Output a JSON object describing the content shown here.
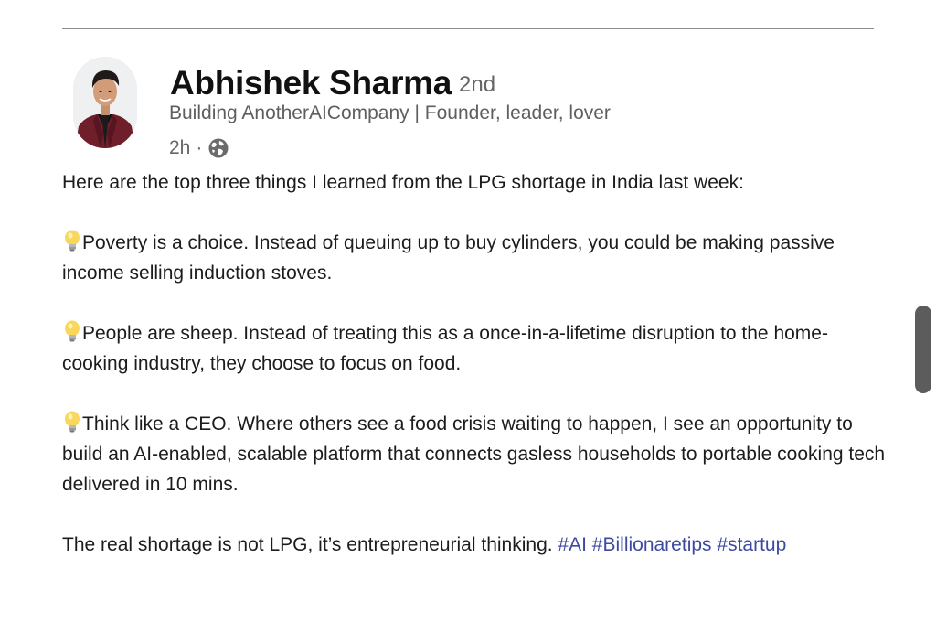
{
  "post": {
    "author": {
      "name": "Abhishek Sharma",
      "degree": "2nd",
      "headline": "Building AnotherAICompany | Founder, leader, lover",
      "time": "2h",
      "separator": "·",
      "visibility_icon": "globe-icon"
    },
    "paragraphs": {
      "intro": "Here are the top three things I learned from the LPG shortage in India last week:",
      "point1": "Poverty is a choice. Instead of queuing up to buy cylinders, you could be making passive income selling induction stoves.",
      "point2": "People are sheep. Instead of treating this as a once-in-a-lifetime disruption to the home-cooking industry, they choose to focus on food.",
      "point3": "Think like a CEO. Where others see a food crisis waiting to happen, I see an opportunity to build an AI-enabled, scalable platform that connects gasless households to portable cooking tech delivered in 10 mins.",
      "closing": "The real shortage is not LPG, it’s entrepreneurial thinking."
    },
    "bullet_icon": "lightbulb-icon",
    "hashtags": [
      "#AI",
      "#Billionaretips",
      "#startup"
    ]
  },
  "colors": {
    "hashtag": "#3d4aa0",
    "scrollbar_thumb": "#5c5c5c",
    "divider": "#8c8c8c"
  }
}
